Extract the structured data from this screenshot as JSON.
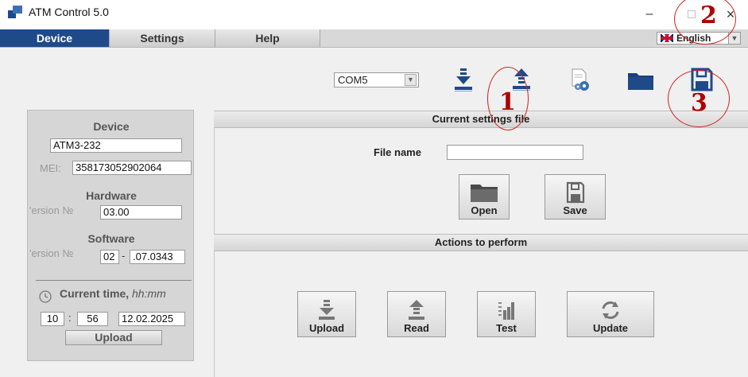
{
  "window": {
    "title": "ATM Control 5.0",
    "minimize": "–",
    "close": "×"
  },
  "menu": {
    "tabs": [
      "Device",
      "Settings",
      "Help"
    ],
    "language": "English"
  },
  "toolbar": {
    "port": "COM5",
    "port_arrow": "▼"
  },
  "device_panel": {
    "device_heading": "Device",
    "device_model": "ATM3-232",
    "imei_label": "MEI:",
    "imei_value": "358173052902064",
    "hardware_heading": "Hardware",
    "hardware_version_label": "'ersion №",
    "hardware_version": "03.00",
    "software_heading": "Software",
    "software_version_label": "'ersion №",
    "software_version_major": "02",
    "software_version_sep": "-",
    "software_version_minor": ".07.0343",
    "time_label": "Current time,",
    "time_format": "hh:mm",
    "hours": "10",
    "time_sep": ":",
    "minutes": "56",
    "date": "12.02.2025",
    "upload_button": "Upload"
  },
  "current_settings": {
    "header": "Current settings file",
    "file_name_label": "File name",
    "file_name_value": "",
    "open_button": "Open",
    "save_button": "Save"
  },
  "actions": {
    "header": "Actions to perform",
    "buttons": [
      "Upload",
      "Read",
      "Test",
      "Update"
    ]
  },
  "annotations": [
    "1",
    "2",
    "3"
  ],
  "colors": {
    "active_tab": "#1f4a8a",
    "icon_blue": "#1f4a8a",
    "annotation_red": "#d42020"
  }
}
